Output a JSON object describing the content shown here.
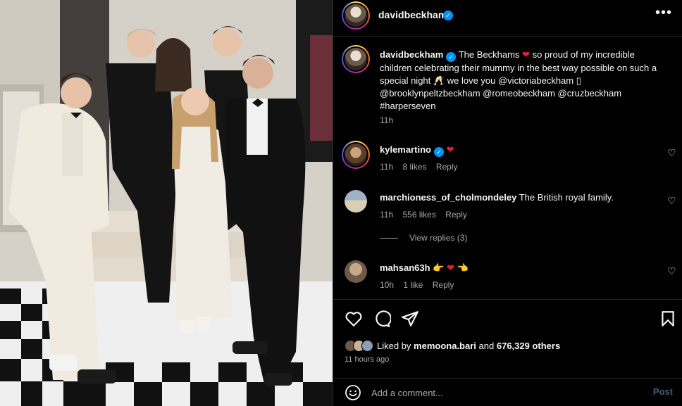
{
  "post": {
    "author": "davidbeckham",
    "verified_icon": "verified-badge-icon",
    "more_icon": "more-options-icon",
    "photo_alt": "The Beckham family posing on a staircase"
  },
  "caption": {
    "username": "davidbeckham",
    "text_1": "The Beckhams",
    "text_2": "so proud of my incredible children celebrating their mummy in the best way possible on such a special night",
    "text_3": "we love you @victoriabeckham",
    "text_4": "@brooklynpeltzbeckham @romeobeckham @cruzbeckham #harperseven",
    "time": "11h"
  },
  "comments": [
    {
      "username": "kylemartino",
      "text": "",
      "time": "11h",
      "likes": "8 likes",
      "reply": "Reply"
    },
    {
      "username": "marchioness_of_cholmondeley",
      "text": "The British royal family.",
      "time": "11h",
      "likes": "556 likes",
      "reply": "Reply"
    },
    {
      "username": "mahsan63h",
      "text": "",
      "time": "10h",
      "likes": "1 like",
      "reply": "Reply"
    }
  ],
  "view_replies": "View replies (3)",
  "actions": {
    "liked_by_prefix": "Liked by",
    "liked_by_user": "memoona.bari",
    "and": "and",
    "others": "676,329 others",
    "posted_ago": "11 hours ago"
  },
  "add_comment": {
    "placeholder": "Add a comment...",
    "post_label": "Post"
  },
  "colors": {
    "background": "#000000",
    "text": "#f5f5f5",
    "muted": "#a8a8a8",
    "verified": "#0095f6",
    "heart": "#ed1c3a",
    "post_button_disabled": "#4a5a73"
  }
}
